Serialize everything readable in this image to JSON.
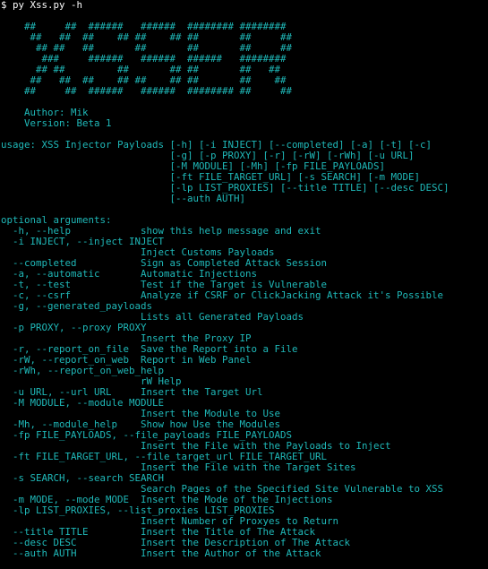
{
  "prompt": "$ py Xss.py -h",
  "banner": [
    "    ##     ##  ######   ######  ######## ########",
    "     ##   ##  ##    ## ##    ## ##       ##     ##",
    "      ## ##   ##       ##       ##       ##     ##",
    "       ###     ######   ######  ######   ########",
    "      ## ##         ##       ## ##       ##   ##",
    "     ##   ##  ##    ## ##    ## ##       ##    ##",
    "    ##     ##  ######   ######  ######## ##     ##"
  ],
  "author_line": "    Author: Mik",
  "version_line": "    Version: Beta 1",
  "usage": [
    "usage: XSS Injector Payloads [-h] [-i INJECT] [--completed] [-a] [-t] [-c]",
    "                             [-g] [-p PROXY] [-r] [-rW] [-rWh] [-u URL]",
    "                             [-M MODULE] [-Mh] [-fp FILE_PAYLOADS]",
    "                             [-ft FILE_TARGET_URL] [-s SEARCH] [-m MODE]",
    "                             [-lp LIST_PROXIES] [--title TITLE] [--desc DESC]",
    "                             [--auth AUTH]"
  ],
  "optional_header": "optional arguments:",
  "arguments": [
    "  -h, --help            show this help message and exit",
    "  -i INJECT, --inject INJECT",
    "                        Inject Customs Payloads",
    "  --completed           Sign as Completed Attack Session",
    "  -a, --automatic       Automatic Injections",
    "  -t, --test            Test if the Target is Vulnerable",
    "  -c, --csrf            Analyze if CSRF or ClickJacking Attack it's Possible",
    "  -g, --generated_payloads",
    "                        Lists all Generated Payloads",
    "  -p PROXY, --proxy PROXY",
    "                        Insert the Proxy IP",
    "  -r, --report_on_file  Save the Report into a File",
    "  -rW, --report_on_web  Report in Web Panel",
    "  -rWh, --report_on_web_help",
    "                        rW Help",
    "  -u URL, --url URL     Insert the Target Url",
    "  -M MODULE, --module MODULE",
    "                        Insert the Module to Use",
    "  -Mh, --module_help    Show how Use the Modules",
    "  -fp FILE_PAYLOADS, --file_payloads FILE_PAYLOADS",
    "                        Insert the File with the Payloads to Inject",
    "  -ft FILE_TARGET_URL, --file_target_url FILE_TARGET_URL",
    "                        Insert the File with the Target Sites",
    "  -s SEARCH, --search SEARCH",
    "                        Search Pages of the Specified Site Vulnerable to XSS",
    "  -m MODE, --mode MODE  Insert the Mode of the Injections",
    "  -lp LIST_PROXIES, --list_proxies LIST_PROXIES",
    "                        Insert Number of Proxyes to Return",
    "  --title TITLE         Insert the Title of The Attack",
    "  --desc DESC           Insert the Description of The Attack",
    "  --auth AUTH           Insert the Author of the Attack"
  ],
  "colors": {
    "background": "#000000",
    "text": "#1fb9b9",
    "prompt": "#ffffff"
  }
}
